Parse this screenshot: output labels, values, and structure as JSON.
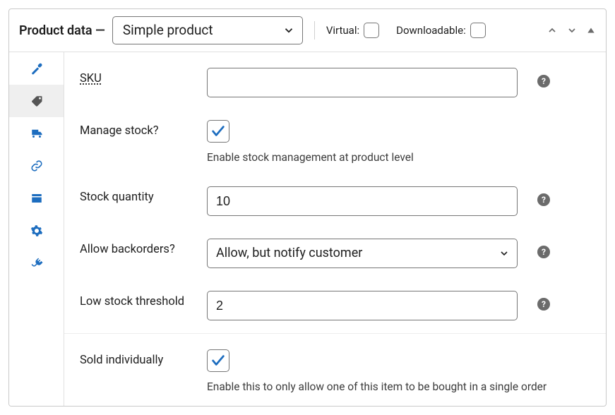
{
  "header": {
    "title": "Product data —",
    "product_type": "Simple product",
    "virtual_label": "Virtual:",
    "downloadable_label": "Downloadable:"
  },
  "tabs": {
    "active_index": 1
  },
  "fields": {
    "sku": {
      "label": "SKU",
      "value": ""
    },
    "manage_stock": {
      "label": "Manage stock?",
      "checked": true,
      "description": "Enable stock management at product level"
    },
    "stock_quantity": {
      "label": "Stock quantity",
      "value": "10"
    },
    "backorders": {
      "label": "Allow backorders?",
      "value": "Allow, but notify customer"
    },
    "low_stock_threshold": {
      "label": "Low stock threshold",
      "value": "2"
    },
    "sold_individually": {
      "label": "Sold individually",
      "checked": true,
      "description": "Enable this to only allow one of this item to be bought in a single order"
    }
  }
}
